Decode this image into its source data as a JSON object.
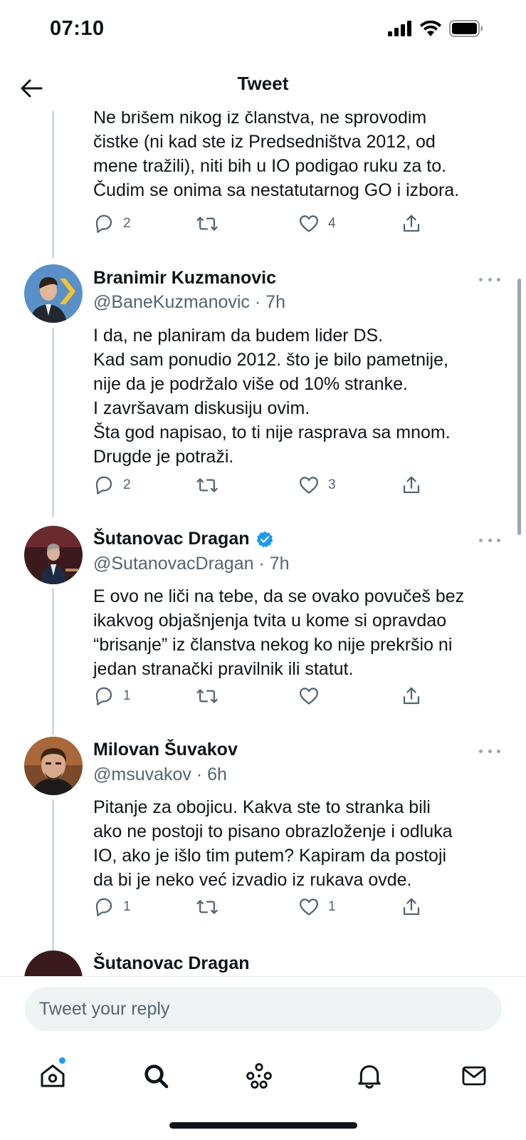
{
  "status_bar": {
    "time": "07:10"
  },
  "header": {
    "title": "Tweet"
  },
  "tweets": [
    {
      "name": "",
      "handle": "",
      "time": "",
      "text": "Ne brišem nikog iz članstva, ne sprovodim\nčistke (ni kad ste iz Predsedništva 2012, od\nmene tražili), niti bih u IO podigao ruku za to.\nČudim se onima sa nestatutarnog GO i izbora.",
      "reply_count": "2",
      "retweet_count": "",
      "like_count": "4"
    },
    {
      "name": "Branimir Kuzmanovic",
      "handle": "@BaneKuzmanovic",
      "time": "· 7h",
      "verified": false,
      "text": "I da, ne planiram da budem lider DS.\nKad sam ponudio 2012. što je bilo pametnije,\nnije da je podržalo više od 10% stranke.\nI završavam diskusiju ovim.\nŠta god napisao, to ti nije rasprava sa mnom.\nDrugde je potraži.",
      "reply_count": "2",
      "retweet_count": "",
      "like_count": "3"
    },
    {
      "name": "Šutanovac Dragan",
      "handle": "@SutanovacDragan",
      "time": "· 7h",
      "verified": true,
      "text": "E ovo ne liči na tebe, da se ovako povučeš bez\nikakvog objašnjenja tvita u kome si opravdao\n“brisanje” iz članstva nekog ko nije prekršio ni\njedan stranački pravilnik ili statut.",
      "reply_count": "1",
      "retweet_count": "",
      "like_count": ""
    },
    {
      "name": "Milovan Šuvakov",
      "handle": "@msuvakov",
      "time": "· 6h",
      "verified": false,
      "text": "Pitanje za obojicu. Kakva ste to stranka bili\nako ne postoji to pisano obrazloženje i odluka\nIO, ako je išlo tim putem? Kapiram da postoji\nda bi je neko već izvadio iz rukava ovde.",
      "reply_count": "1",
      "retweet_count": "",
      "like_count": "1"
    }
  ],
  "partial_tweet": {
    "name": "Šutanovac Dragan"
  },
  "reply_bar": {
    "placeholder": "Tweet your reply"
  },
  "tab_bar": {
    "items": [
      "home-icon",
      "search-icon",
      "spaces-icon",
      "notifications-icon",
      "messages-icon"
    ],
    "accent": "#1d9bf0"
  },
  "colors": {
    "text": "#0f1419",
    "secondary": "#536471",
    "verified": "#1d9bf0",
    "thread_line": "#cfd9de"
  }
}
